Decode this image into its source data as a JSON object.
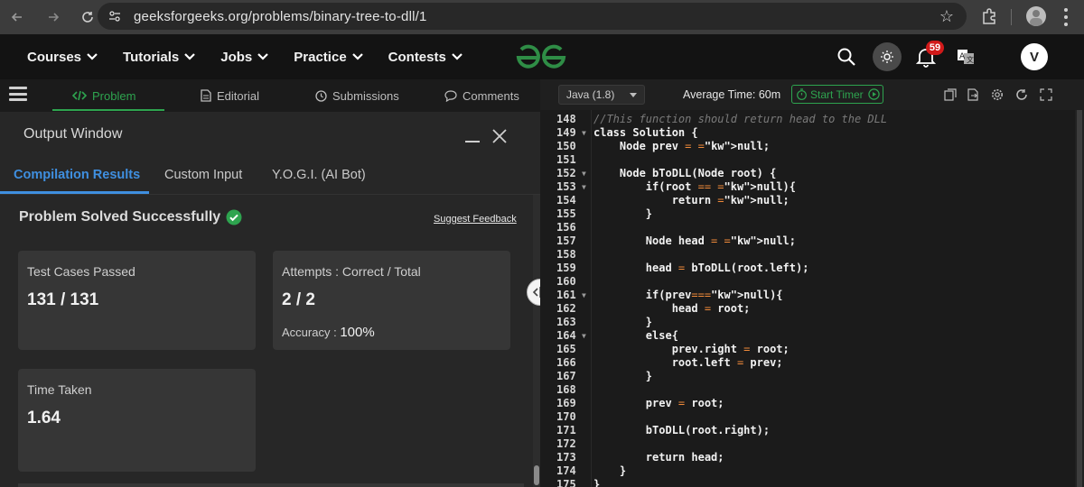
{
  "browser": {
    "url": "geeksforgeeks.org/problems/binary-tree-to-dll/1",
    "back_icon": "arrow-left-icon",
    "forward_icon": "arrow-right-icon",
    "reload_icon": "reload-icon"
  },
  "header": {
    "menu": [
      {
        "label": "Courses"
      },
      {
        "label": "Tutorials"
      },
      {
        "label": "Jobs"
      },
      {
        "label": "Practice"
      },
      {
        "label": "Contests"
      }
    ],
    "notification_count": "59",
    "avatar_letter": "V",
    "brand_color": "#2f8d46"
  },
  "problem_tabs": [
    {
      "label": "Problem",
      "icon": "code-icon",
      "active": true
    },
    {
      "label": "Editorial",
      "icon": "document-icon"
    },
    {
      "label": "Submissions",
      "icon": "clock-icon"
    },
    {
      "label": "Comments",
      "icon": "comment-icon"
    }
  ],
  "output": {
    "title": "Output Window",
    "tabs": [
      {
        "label": "Compilation Results",
        "active": true
      },
      {
        "label": "Custom Input"
      },
      {
        "label": "Y.O.G.I. (AI Bot)"
      }
    ],
    "status": "Problem Solved Successfully",
    "feedback_link": "Suggest Feedback",
    "cards": {
      "test_cases": {
        "label": "Test Cases Passed",
        "value": "131 / 131"
      },
      "attempts": {
        "label": "Attempts : Correct / Total",
        "value": "2 / 2",
        "accuracy_label": "Accuracy :",
        "accuracy_value": "100%"
      },
      "time": {
        "label": "Time Taken",
        "value": "1.64"
      }
    }
  },
  "editor": {
    "language": "Java (1.8)",
    "average_time": "Average Time: 60m",
    "timer_label": "Start Timer",
    "lines": [
      {
        "n": "148",
        "code": "//This function should return head to the DLL"
      },
      {
        "n": "149",
        "code": "class Solution {",
        "fold": true
      },
      {
        "n": "150",
        "code": "    Node prev = null;"
      },
      {
        "n": "151",
        "code": ""
      },
      {
        "n": "152",
        "code": "    Node bToDLL(Node root) {",
        "fold": true
      },
      {
        "n": "153",
        "code": "        if(root == null){",
        "fold": true
      },
      {
        "n": "154",
        "code": "            return null;"
      },
      {
        "n": "155",
        "code": "        }"
      },
      {
        "n": "156",
        "code": ""
      },
      {
        "n": "157",
        "code": "        Node head = null;"
      },
      {
        "n": "158",
        "code": ""
      },
      {
        "n": "159",
        "code": "        head = bToDLL(root.left);"
      },
      {
        "n": "160",
        "code": ""
      },
      {
        "n": "161",
        "code": "        if(prev==null){",
        "fold": true
      },
      {
        "n": "162",
        "code": "            head = root;"
      },
      {
        "n": "163",
        "code": "        }"
      },
      {
        "n": "164",
        "code": "        else{",
        "fold": true
      },
      {
        "n": "165",
        "code": "            prev.right = root;"
      },
      {
        "n": "166",
        "code": "            root.left = prev;"
      },
      {
        "n": "167",
        "code": "        }"
      },
      {
        "n": "168",
        "code": ""
      },
      {
        "n": "169",
        "code": "        prev = root;"
      },
      {
        "n": "170",
        "code": ""
      },
      {
        "n": "171",
        "code": "        bToDLL(root.right);"
      },
      {
        "n": "172",
        "code": ""
      },
      {
        "n": "173",
        "code": "        return head;"
      },
      {
        "n": "174",
        "code": "    }"
      },
      {
        "n": "175",
        "code": "}"
      }
    ]
  }
}
